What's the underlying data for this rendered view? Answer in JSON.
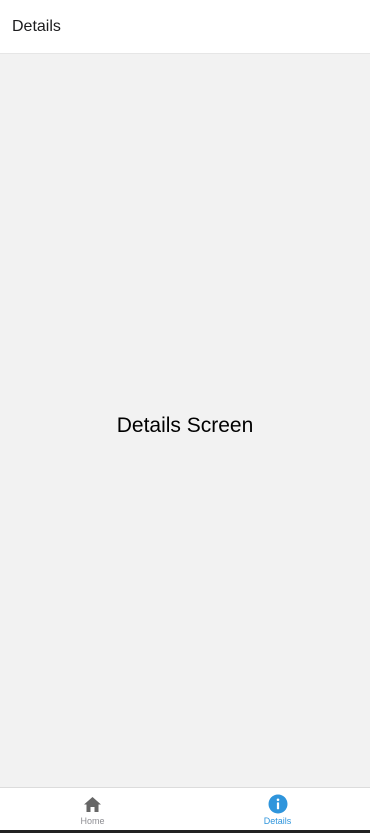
{
  "header": {
    "title": "Details"
  },
  "main": {
    "screen_label": "Details Screen"
  },
  "tabbar": {
    "tabs": [
      {
        "label": "Home",
        "icon": "home-icon",
        "active": false
      },
      {
        "label": "Details",
        "icon": "info-icon",
        "active": true
      }
    ]
  },
  "colors": {
    "active_tint": "#2f95dc",
    "inactive_tint": "#8e8e93",
    "content_background": "#f2f2f2",
    "header_background": "#ffffff"
  }
}
